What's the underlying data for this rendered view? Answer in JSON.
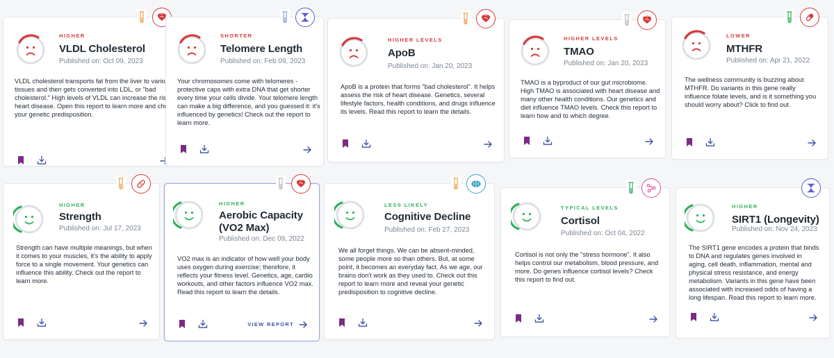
{
  "colors": {
    "red": "#d63a3a",
    "green": "#2fb15d",
    "purple": "#5a58d6",
    "teal": "#3aa3c9",
    "pink": "#d64fa8",
    "bookmark": "#7b2a84",
    "link_blue": "#3d4fa3"
  },
  "cards": [
    {
      "level": "HIGHER",
      "title": "VLDL Cholesterol",
      "published": "Published on: Oct 09, 2023",
      "description": "VLDL cholesterol transports fat from the liver to various tissues and then gets converted into LDL, or \"bad cholesterol.\" High levels of VLDL can increase the risk of heart disease. Open this report to learn more and check your genetic predisposition.",
      "mood": "sad",
      "tone": "red",
      "tube": "orange",
      "category_icon": "heart-icon"
    },
    {
      "level": "SHORTER",
      "title": "Telomere Length",
      "published": "Published on: Feb 09, 2023",
      "description": "Your chromosomes come with telomeres - protective caps with extra DNA that get shorter every time your cells divide. Your telomere length can make a big difference, and you guessed it: it's influenced by genetics! Check out the report to learn more.",
      "mood": "sad",
      "tone": "red",
      "tube": "blue",
      "category_icon": "hourglass-icon"
    },
    {
      "level": "HIGHER LEVELS",
      "title": "ApoB",
      "published": "Published on: Jan 20, 2023",
      "description": "ApoB is a protein that forms \"bad cholesterol\". It helps assess the risk of heart disease. Genetics, several lifestyle factors, health conditions, and drugs influence its levels. Read this report to learn the details.",
      "mood": "sad",
      "tone": "red",
      "tube": "orange",
      "category_icon": "heart-icon"
    },
    {
      "level": "HIGHER LEVELS",
      "title": "TMAO",
      "published": "Published on: Jan 20, 2023",
      "description": "TMAO is a byproduct of our gut microbiome. High TMAO is associated with heart disease and many other health conditions. Our genetics and diet influence TMAO levels. Check this report to learn how and to which degree.",
      "mood": "sad",
      "tone": "red",
      "tube": "gray",
      "category_icon": "heart-icon"
    },
    {
      "level": "LOWER",
      "title": "MTHFR",
      "published": "Published on: Apr 21, 2022",
      "description": "The wellness community is buzzing about MTHFR. Do variants in this gene really influence folate levels, and is it something you should worry about? Click to find out.",
      "mood": "sad",
      "tone": "red",
      "tube": "green",
      "category_icon": "pill-icon"
    },
    {
      "level": "HIGHER",
      "title": "Strength",
      "published": "Published on: Jul 17, 2023",
      "description": "Strength can have multiple meanings, but when it comes to your muscles, it's the ability to apply force to a single movement. Your genetics can influence this ability. Check out the report to learn more.",
      "mood": "happy",
      "tone": "green",
      "tube": "orange",
      "category_icon": "bandage-icon"
    },
    {
      "level": "HIGHER",
      "title": "Aerobic Capacity (VO2 Max)",
      "published": "Published on: Dec 09, 2022",
      "description": "VO2 max is an indicator of how well your body uses oxygen during exercise; therefore, it reflects your fitness level. Genetics, age, cardio workouts, and other factors influence VO2 max. Read this report to learn the details.",
      "mood": "happy",
      "tone": "green",
      "tube": "gray",
      "category_icon": "heart-icon",
      "action_label": "VIEW REPORT"
    },
    {
      "level": "LESS LIKELY",
      "title": "Cognitive Decline",
      "published": "Published on: Feb 27, 2023",
      "description": "We all forget things. We can be absent-minded, some people more so than others. But, at some point, it becomes an everyday fact. As we age, our brains don't work as they used to. Check out this report to learn more and reveal your genetic predisposition to cognitive decline.",
      "mood": "happy",
      "tone": "green",
      "tube": "orange",
      "category_icon": "brain-icon"
    },
    {
      "level": "TYPICAL LEVELS",
      "title": "Cortisol",
      "published": "Published on: Oct 04, 2022",
      "description": "Cortisol is not only the \"stress hormone\". It also helps control our metabolism, blood pressure, and more. Do genes influence cortisol levels? Check this report to find out.",
      "mood": "happy",
      "tone": "green",
      "tube": "green",
      "category_icon": "molecule-icon"
    },
    {
      "level": "HIGHER",
      "title": "SIRT1 (Longevity)",
      "published": "Published on: Nov 24, 2023",
      "description": "The SIRT1 gene encodes a protein that binds to DNA and regulates genes involved in aging, cell death, inflammation, mental and physical stress resistance, and energy metabolism. Variants in this gene have been associated with increased odds of having a long lifespan. Read this report to learn more.",
      "mood": "happy",
      "tone": "green",
      "tube": "none",
      "category_icon": "hourglass-icon"
    }
  ]
}
